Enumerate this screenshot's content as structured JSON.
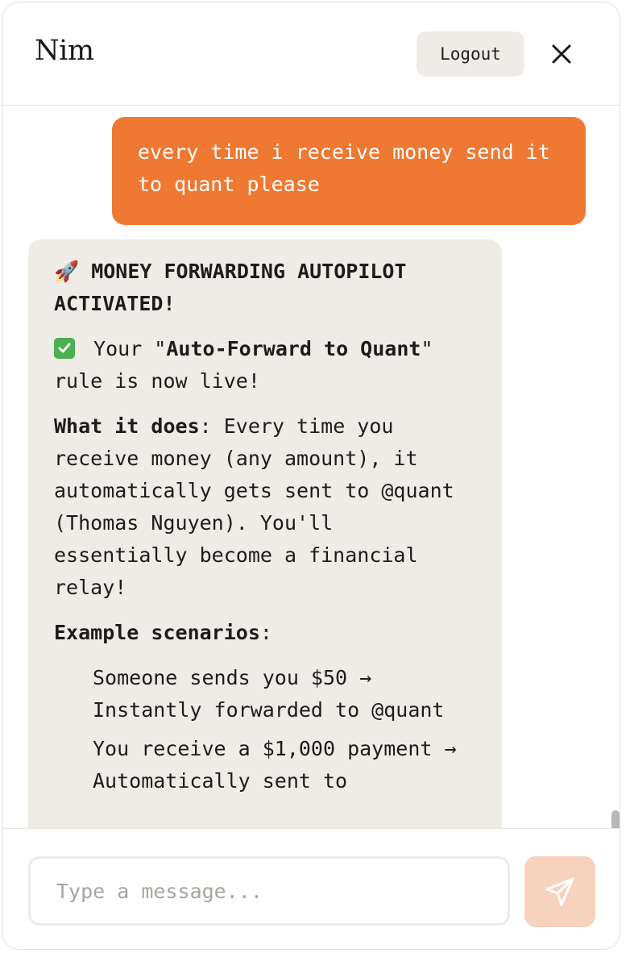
{
  "header": {
    "title": "Nim",
    "logout_label": "Logout"
  },
  "messages": {
    "user": {
      "text": "every time i receive money send it to quant please"
    },
    "bot": {
      "title": "MONEY FORWARDING AUTOPILOT ACTIVATED!",
      "rocket_emoji": "🚀",
      "confirm_prefix": " Your \"",
      "rule_name": "Auto-Forward to Quant",
      "confirm_suffix": "\" rule is now live!",
      "what_label": "What it does",
      "what_text": ": Every time you receive money (any amount), it automatically gets sent to @quant (Thomas Nguyen). You'll essentially become a financial relay!",
      "examples_label": "Example scenarios",
      "examples_colon": ":",
      "examples": [
        "Someone sends you $50 → Instantly forwarded to @quant",
        "You receive a $1,000 payment → Automatically sent to"
      ]
    }
  },
  "composer": {
    "placeholder": "Type a message..."
  },
  "colors": {
    "accent": "#ef7832",
    "bot_bubble": "#efece7",
    "send_button": "#f7d2bd"
  },
  "icons": {
    "close": "close-icon",
    "send": "send-icon",
    "check": "check-icon",
    "rocket": "rocket-icon"
  }
}
